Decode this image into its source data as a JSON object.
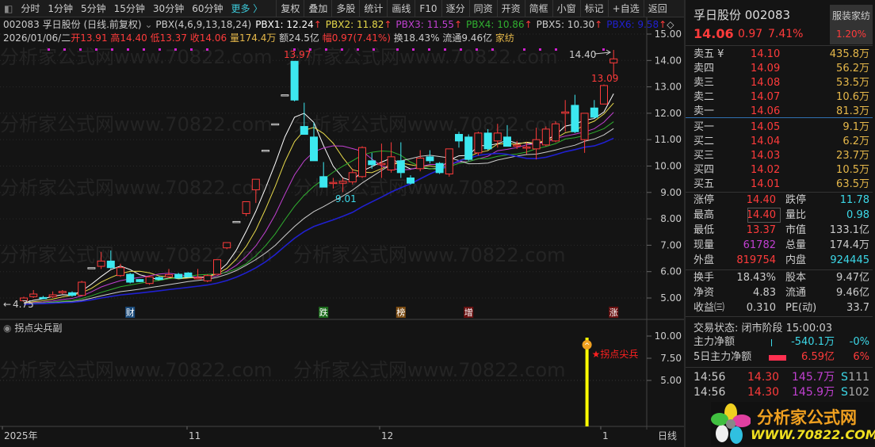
{
  "toolbar": {
    "periods": [
      "分时",
      "1分钟",
      "5分钟",
      "15分钟",
      "30分钟",
      "60分钟"
    ],
    "more": "更多 〉",
    "buttons": [
      "复权",
      "叠加",
      "多股",
      "统计",
      "画线",
      "F10",
      "逐分",
      "同资",
      "开资",
      "简框",
      "小窗",
      "标记",
      "+自选",
      "返回"
    ]
  },
  "info": {
    "line1_prefix": "002083 孚日股份 (日线.前复权)",
    "indicator": "PBX(4,6,9,13,18,24)",
    "pbx": [
      {
        "label": "PBX1: 12.24",
        "color": "#ffffff"
      },
      {
        "label": "PBX2: 11.82",
        "color": "#e6d84a"
      },
      {
        "label": "PBX3: 11.55",
        "color": "#c040d0"
      },
      {
        "label": "PBX4: 10.86",
        "color": "#30b030"
      },
      {
        "label": "PBX5: 10.30",
        "color": "#cccccc"
      },
      {
        "label": "PBX6: 9.58",
        "color": "#2020d0"
      }
    ],
    "date": "2026/01/06/二",
    "open": "开13.91",
    "high": "高14.40",
    "low": "低13.37",
    "close": "收14.06",
    "vol": "量174.4万",
    "amount": "额24.5亿",
    "change": "幅0.97(7.41%)",
    "turnover": "换18.43%",
    "float": "流通9.46亿",
    "sector": "家纺"
  },
  "chart_data": {
    "type": "candlestick",
    "title": "孚日股份 日线",
    "ylim": [
      4.6,
      15.3
    ],
    "yticks": [
      "15.00",
      "14.00",
      "13.00",
      "12.00",
      "11.00",
      "10.00",
      "9.00",
      "8.00",
      "7.00",
      "6.00",
      "5.00"
    ],
    "candles": [
      [
        4.9,
        5.05,
        4.85,
        5.0
      ],
      [
        5.05,
        5.3,
        5.0,
        5.15
      ],
      [
        5.02,
        5.08,
        4.95,
        4.98
      ],
      [
        5.05,
        5.25,
        5.0,
        5.12
      ],
      [
        5.2,
        5.3,
        5.15,
        5.25
      ],
      [
        5.2,
        5.25,
        5.05,
        5.1
      ],
      [
        5.1,
        5.65,
        5.1,
        5.6
      ],
      [
        6.15,
        6.15,
        6.15,
        6.15
      ],
      [
        6.2,
        6.75,
        6.1,
        6.4
      ],
      [
        6.4,
        6.8,
        6.1,
        6.15
      ],
      [
        5.85,
        6.3,
        5.8,
        6.15
      ],
      [
        5.9,
        5.95,
        5.55,
        5.6
      ],
      [
        5.7,
        5.72,
        5.6,
        5.62
      ],
      [
        5.55,
        5.85,
        5.5,
        5.8
      ],
      [
        5.78,
        5.82,
        5.7,
        5.7
      ],
      [
        5.8,
        6.1,
        5.75,
        5.88
      ],
      [
        5.9,
        5.95,
        5.75,
        5.75
      ],
      [
        5.95,
        5.98,
        5.78,
        5.8
      ],
      [
        5.75,
        6.1,
        5.72,
        5.77
      ],
      [
        5.65,
        5.9,
        5.6,
        5.85
      ],
      [
        5.9,
        6.45,
        5.9,
        6.45
      ],
      [
        6.9,
        7.1,
        6.85,
        7.1
      ],
      [
        7.9,
        7.9,
        7.9,
        7.9
      ],
      [
        8.2,
        8.65,
        8.1,
        8.65
      ],
      [
        9.1,
        9.5,
        8.6,
        9.5
      ],
      [
        10.6,
        10.6,
        10.6,
        10.6
      ],
      [
        11.6,
        11.6,
        11.6,
        11.6
      ],
      [
        12.7,
        12.7,
        12.7,
        12.7
      ],
      [
        13.97,
        13.97,
        12.45,
        12.5
      ],
      [
        11.5,
        12.4,
        11.2,
        11.2
      ],
      [
        11.1,
        11.65,
        10.2,
        10.2
      ],
      [
        9.6,
        10.15,
        9.2,
        9.2
      ],
      [
        9.35,
        9.55,
        9.15,
        9.38
      ],
      [
        9.35,
        9.55,
        9.01,
        9.42
      ],
      [
        9.4,
        9.9,
        9.3,
        9.75
      ],
      [
        9.6,
        10.75,
        9.55,
        10.7
      ],
      [
        10.2,
        10.5,
        9.9,
        10.05
      ],
      [
        10.05,
        10.85,
        9.55,
        10.1
      ],
      [
        9.85,
        10.9,
        9.75,
        10.35
      ],
      [
        10.2,
        10.9,
        9.55,
        9.75
      ],
      [
        9.55,
        9.65,
        9.3,
        9.35
      ],
      [
        9.9,
        10.6,
        9.8,
        10.3
      ],
      [
        10.35,
        10.6,
        10.1,
        10.2
      ],
      [
        10.1,
        10.15,
        9.7,
        9.75
      ],
      [
        9.7,
        10.65,
        9.6,
        10.65
      ],
      [
        11.2,
        11.3,
        10.7,
        10.95
      ],
      [
        11.1,
        11.2,
        10.2,
        10.25
      ],
      [
        10.5,
        11.3,
        10.4,
        11.25
      ],
      [
        11.25,
        11.4,
        10.6,
        10.65
      ],
      [
        10.95,
        11.6,
        10.7,
        11.25
      ],
      [
        11.1,
        11.55,
        10.75,
        10.75
      ],
      [
        10.8,
        10.95,
        10.65,
        10.8
      ],
      [
        10.7,
        10.9,
        10.45,
        10.72
      ],
      [
        10.65,
        11.45,
        10.25,
        11.0
      ],
      [
        10.8,
        11.5,
        10.75,
        11.4
      ],
      [
        10.95,
        11.7,
        10.9,
        11.6
      ],
      [
        12.0,
        12.5,
        11.3,
        12.05
      ],
      [
        12.3,
        12.7,
        11.25,
        11.3
      ],
      [
        11.0,
        12.0,
        10.5,
        12.0
      ],
      [
        12.2,
        12.5,
        11.8,
        11.85
      ],
      [
        12.35,
        13.09,
        12.35,
        13.05
      ],
      [
        13.91,
        14.4,
        13.37,
        14.06
      ]
    ],
    "ma_periods": [
      4,
      6,
      9,
      13,
      18,
      24
    ],
    "ma_colors": [
      "#ffffff",
      "#e6d84a",
      "#c040d0",
      "#30b030",
      "#cccccc",
      "#2020d0"
    ],
    "annotations": {
      "high": "13.97",
      "low": "9.01",
      "last_high": "14.40",
      "last_low": "13.09",
      "left_min": "4.75"
    },
    "events": [
      {
        "index": 11,
        "label": "财",
        "color": "#1a4a7a"
      },
      {
        "index": 31,
        "label": "跌",
        "color": "#1a6a1a"
      },
      {
        "index": 39,
        "label": "榜",
        "color": "#7a4a10"
      },
      {
        "index": 46,
        "label": "增",
        "color": "#6a1010"
      },
      {
        "index": 61,
        "label": "涨",
        "color": "#6a1010"
      }
    ]
  },
  "sub": {
    "title": "拐点尖兵副",
    "yticks": [
      "10.00",
      "7.50",
      "5.00"
    ],
    "signal": "★拐点尖兵",
    "signal_index": 58
  },
  "xaxis": {
    "labels": [
      "2025年",
      "11",
      "12",
      "1"
    ],
    "period": "日线"
  },
  "watermark": "分析家公式网www.70822.com",
  "right": {
    "name": "孚日股份 002083",
    "sector": "服装家纺",
    "sector_pct": "1.20%",
    "price": "14.06",
    "chg": "0.97",
    "pct": "7.41%",
    "asks": [
      [
        "卖五 ¥",
        "14.10",
        "435.8万"
      ],
      [
        "卖四",
        "14.09",
        "56.2万"
      ],
      [
        "卖三",
        "14.08",
        "53.5万"
      ],
      [
        "卖二",
        "14.07",
        "10.6万"
      ],
      [
        "卖一",
        "14.06",
        "81.3万"
      ]
    ],
    "bids": [
      [
        "买一",
        "14.05",
        "9.1万"
      ],
      [
        "买二",
        "14.04",
        "6.2万"
      ],
      [
        "买三",
        "14.03",
        "23.7万"
      ],
      [
        "买四",
        "14.02",
        "10.5万"
      ],
      [
        "买五",
        "14.01",
        "63.5万"
      ]
    ],
    "stats": [
      [
        "涨停",
        "14.40",
        "跌停",
        "11.78"
      ],
      [
        "最高",
        "14.40",
        "量比",
        "0.98"
      ],
      [
        "最低",
        "13.37",
        "市值",
        "133.1亿"
      ],
      [
        "现量",
        "61782",
        "总量",
        "174.4万"
      ],
      [
        "外盘",
        "819754",
        "内盘",
        "924445"
      ]
    ],
    "stats2": [
      [
        "换手",
        "18.43%",
        "股本",
        "9.47亿"
      ],
      [
        "净资",
        "4.83",
        "流通",
        "9.46亿"
      ],
      [
        "收益㈢",
        "0.310",
        "PE(动)",
        "33.7"
      ]
    ],
    "status": "交易状态: 闭市阶段 15:00:03",
    "flow": [
      [
        "主力净额",
        "-540.1万",
        "-0%"
      ],
      [
        "5日主力净额",
        "6.59亿",
        "6%"
      ]
    ],
    "trades": [
      [
        "14:56",
        "14.30",
        "145.7万",
        "S",
        "111"
      ],
      [
        "14:56",
        "14.30",
        "145.9万",
        "S",
        "102"
      ]
    ],
    "logo": {
      "text": "分析家公式网",
      "url": "WWW.70822.COM"
    }
  }
}
